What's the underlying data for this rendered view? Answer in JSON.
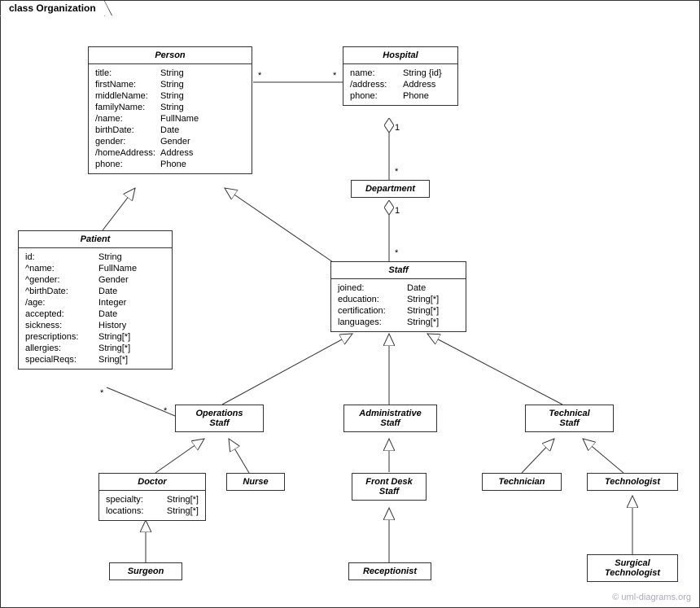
{
  "frame_title": "class Organization",
  "watermark": "© uml-diagrams.org",
  "classes": {
    "person": {
      "title": "Person",
      "attrs": [
        {
          "name": "title:",
          "type": "String"
        },
        {
          "name": "firstName:",
          "type": "String"
        },
        {
          "name": "middleName:",
          "type": "String"
        },
        {
          "name": "familyName:",
          "type": "String"
        },
        {
          "name": "/name:",
          "type": "FullName"
        },
        {
          "name": "birthDate:",
          "type": "Date"
        },
        {
          "name": "gender:",
          "type": "Gender"
        },
        {
          "name": "/homeAddress:",
          "type": "Address"
        },
        {
          "name": "phone:",
          "type": "Phone"
        }
      ]
    },
    "hospital": {
      "title": "Hospital",
      "attrs": [
        {
          "name": "name:",
          "type": "String {id}"
        },
        {
          "name": "/address:",
          "type": "Address"
        },
        {
          "name": "phone:",
          "type": "Phone"
        }
      ]
    },
    "department": {
      "title": "Department"
    },
    "patient": {
      "title": "Patient",
      "attrs": [
        {
          "name": "id:",
          "type": "String"
        },
        {
          "name": "^name:",
          "type": "FullName"
        },
        {
          "name": "^gender:",
          "type": "Gender"
        },
        {
          "name": "^birthDate:",
          "type": "Date"
        },
        {
          "name": "/age:",
          "type": "Integer"
        },
        {
          "name": "accepted:",
          "type": "Date"
        },
        {
          "name": "sickness:",
          "type": "History"
        },
        {
          "name": "prescriptions:",
          "type": "String[*]"
        },
        {
          "name": "allergies:",
          "type": "String[*]"
        },
        {
          "name": "specialReqs:",
          "type": "Sring[*]"
        }
      ]
    },
    "staff": {
      "title": "Staff",
      "attrs": [
        {
          "name": "joined:",
          "type": "Date"
        },
        {
          "name": "education:",
          "type": "String[*]"
        },
        {
          "name": "certification:",
          "type": "String[*]"
        },
        {
          "name": "languages:",
          "type": "String[*]"
        }
      ]
    },
    "operations_staff": {
      "title": "Operations<br>Staff"
    },
    "administrative_staff": {
      "title": "Administrative<br>Staff"
    },
    "technical_staff": {
      "title": "Technical<br>Staff"
    },
    "doctor": {
      "title": "Doctor",
      "attrs": [
        {
          "name": "specialty:",
          "type": "String[*]"
        },
        {
          "name": "locations:",
          "type": "String[*]"
        }
      ]
    },
    "nurse": {
      "title": "Nurse"
    },
    "front_desk_staff": {
      "title": "Front Desk<br>Staff"
    },
    "technician": {
      "title": "Technician"
    },
    "technologist": {
      "title": "Technologist"
    },
    "surgeon": {
      "title": "Surgeon"
    },
    "receptionist": {
      "title": "Receptionist"
    },
    "surgical_technologist": {
      "title": "Surgical<br>Technologist"
    }
  },
  "multi": {
    "m1": "*",
    "m2": "*",
    "m3": "1",
    "m4": "*",
    "m5": "1",
    "m6": "*",
    "m7": "*",
    "m8": "*"
  }
}
